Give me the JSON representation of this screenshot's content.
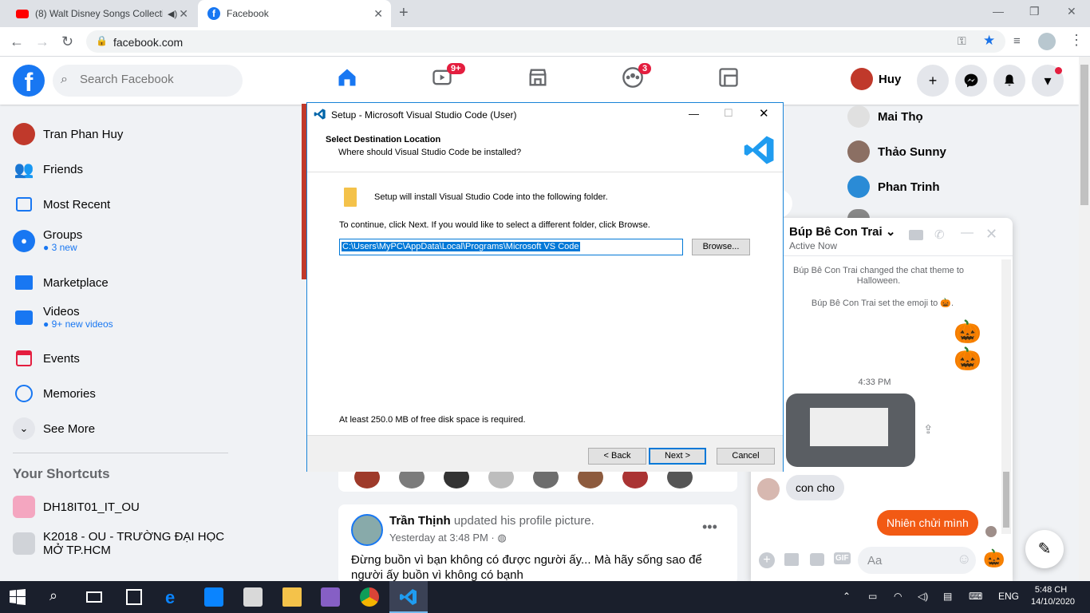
{
  "browser": {
    "tabs": [
      {
        "label": "(8) Walt Disney Songs Collecti"
      },
      {
        "label": "Facebook"
      }
    ],
    "url": "facebook.com"
  },
  "fb": {
    "search_placeholder": "Search Facebook",
    "watch_badge": "9+",
    "groups_badge": "3",
    "profile_name": "Huy",
    "sidebar": {
      "user": "Tran Phan Huy",
      "friends": "Friends",
      "most_recent": "Most Recent",
      "groups": "Groups",
      "groups_sub": "3 new",
      "marketplace": "Marketplace",
      "videos": "Videos",
      "videos_sub": "9+ new videos",
      "events": "Events",
      "memories": "Memories",
      "see_more": "See More",
      "shortcuts_title": "Your Shortcuts",
      "shortcut1": "DH18IT01_IT_OU",
      "shortcut2": "K2018 - OU - TRƯỜNG ĐẠI HỌC MỞ TP.HCM"
    },
    "contacts": [
      "Mai Thọ",
      "Thảo Sunny",
      "Phan Trinh"
    ],
    "chat": {
      "name": "Búp Bê Con Trai",
      "status": "Active Now",
      "event1": "Búp Bê Con Trai changed the chat theme to Halloween.",
      "event2": "Búp Bê Con Trai set the emoji to",
      "time": "4:33 PM",
      "msg_in": "con cho",
      "msg_out": "Nhiên chửi mình",
      "input_placeholder": "Aa"
    },
    "post": {
      "author": "Trần Thịnh",
      "action": "updated his profile picture.",
      "time": "Yesterday at 3:48 PM ·",
      "text": "Đừng buồn vì bạn không có được người ấy... Mà hãy sống sao để người ấy buồn vì không có bạnh"
    }
  },
  "dialog": {
    "title": "Setup - Microsoft Visual Studio Code (User)",
    "heading": "Select Destination Location",
    "subheading": "Where should Visual Studio Code be installed?",
    "info": "Setup will install Visual Studio Code into the following folder.",
    "instruction": "To continue, click Next. If you would like to select a different folder, click Browse.",
    "path": "C:\\Users\\MyPC\\AppData\\Local\\Programs\\Microsoft VS Code",
    "browse": "Browse...",
    "disk": "At least 250.0 MB of free disk space is required.",
    "back": "< Back",
    "next": "Next >",
    "cancel": "Cancel"
  },
  "taskbar": {
    "lang": "ENG",
    "time": "5:48 CH",
    "date": "14/10/2020"
  },
  "colors": {
    "fb_blue": "#1877f2",
    "chat_orange": "#f25a14",
    "vs_blue": "#0065a9",
    "taskbar": "#1a1f2c"
  }
}
